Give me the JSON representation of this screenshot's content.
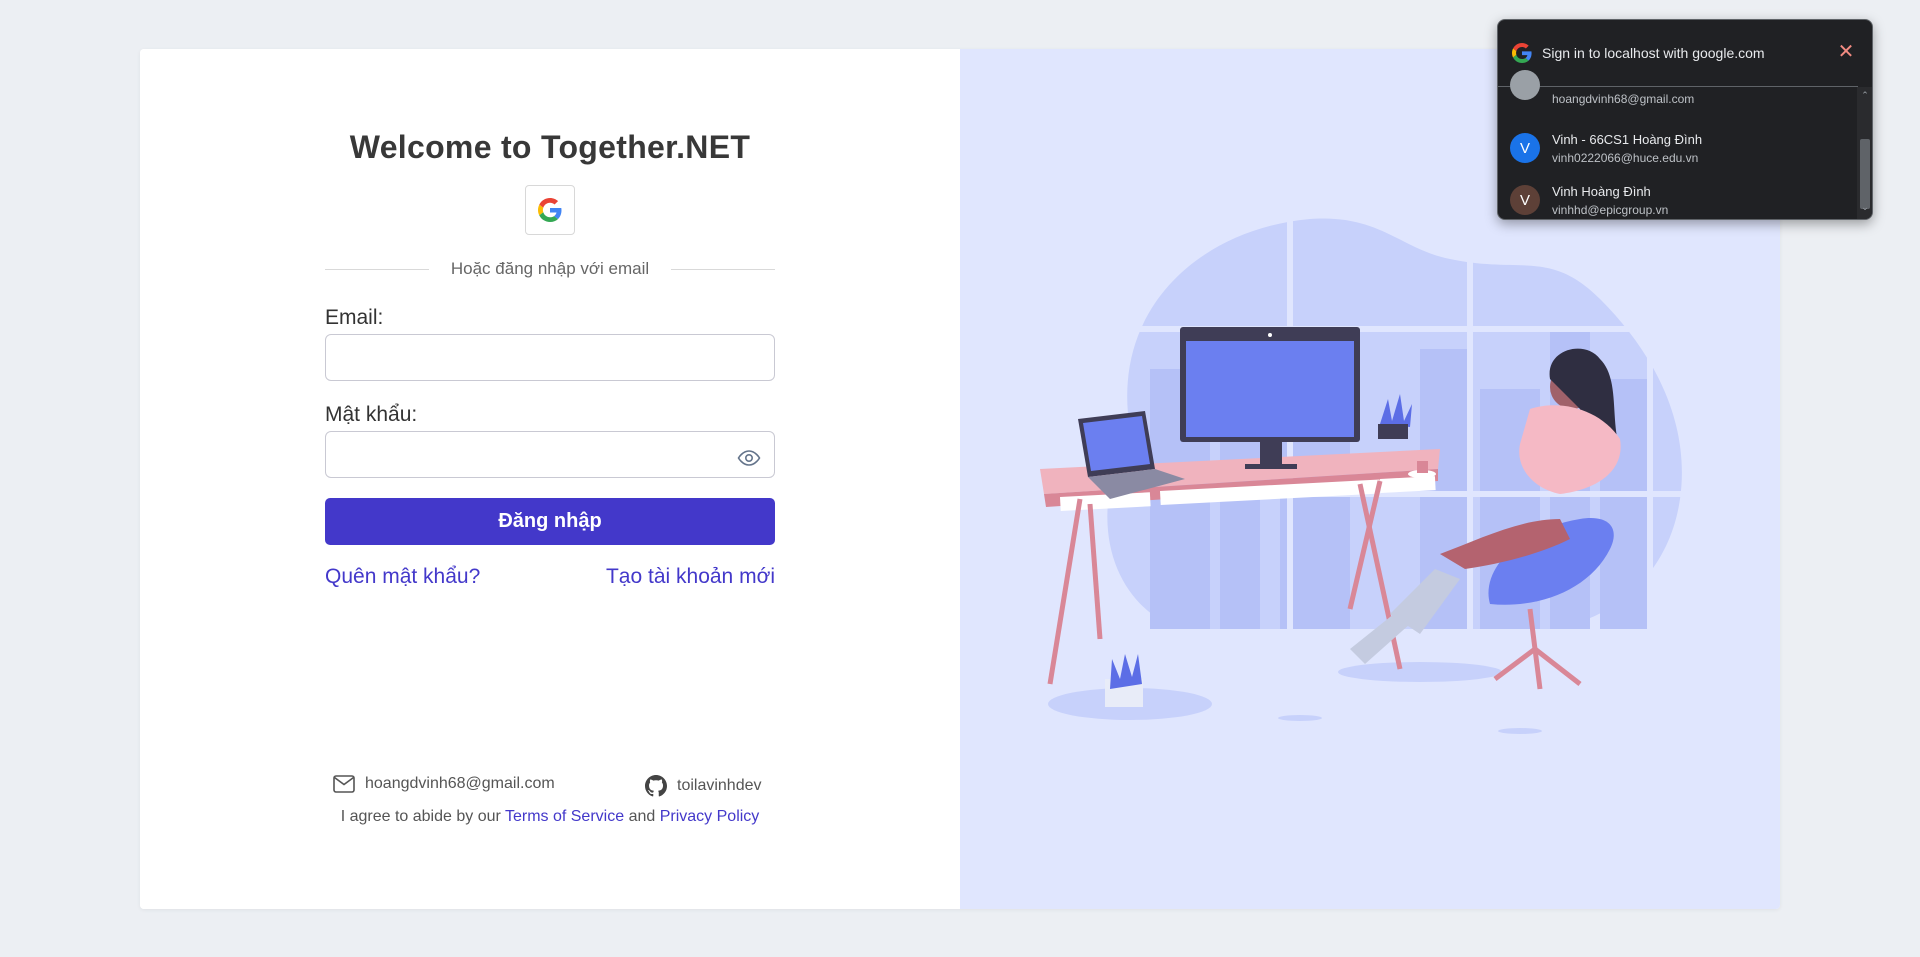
{
  "login": {
    "title": "Welcome to Together.NET",
    "divider_text": "Hoặc đăng nhập với email",
    "email_label": "Email:",
    "email_value": "",
    "password_label": "Mật khẩu:",
    "password_value": "",
    "submit_label": "Đăng nhập",
    "forgot_label": "Quên mật khẩu?",
    "register_label": "Tạo tài khoản mới"
  },
  "footer": {
    "email": "hoangdvinh68@gmail.com",
    "github": "toilavinhdev",
    "terms_prefix": "I agree to abide by our",
    "terms_link": "Terms of Service",
    "and": "and",
    "privacy_link": "Privacy Policy"
  },
  "google_popup": {
    "title": "Sign in to localhost with google.com",
    "accounts": [
      {
        "name": "",
        "email": "hoangdvinh68@gmail.com",
        "initial": "",
        "color": "#9aa0a6"
      },
      {
        "name": "Vinh - 66CS1 Hoàng Đình",
        "email": "vinh0222066@huce.edu.vn",
        "initial": "V",
        "color": "#1a73e8"
      },
      {
        "name": "Vinh Hoàng Đình",
        "email": "vinhhd@epicgroup.vn",
        "initial": "V",
        "color": "#5d4037"
      }
    ]
  },
  "colors": {
    "accent": "#4338ca",
    "illustration_bg": "#e0e6fe",
    "page_bg": "#eceff3"
  }
}
